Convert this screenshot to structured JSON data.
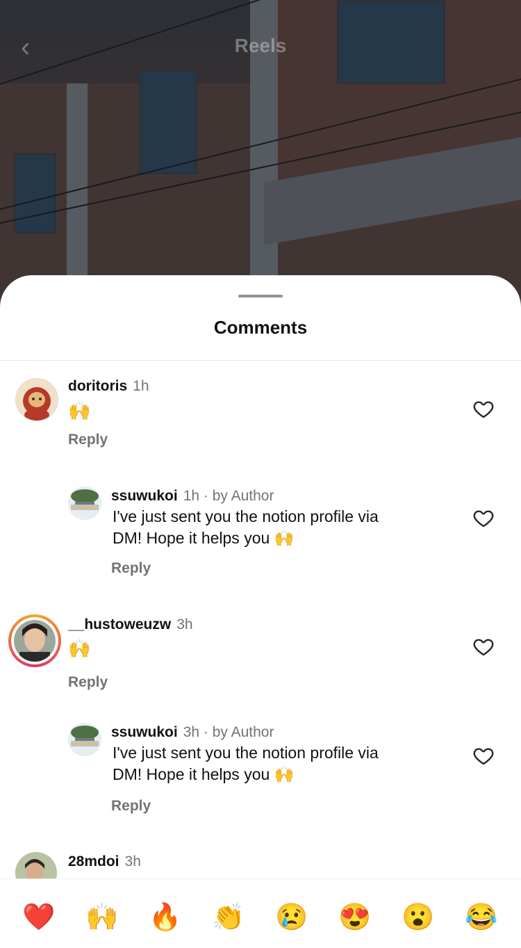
{
  "header": {
    "title": "Reels"
  },
  "sheet": {
    "title": "Comments"
  },
  "comments": [
    {
      "username": "doritoris",
      "time": "1h",
      "text": "🙌",
      "reply_label": "Reply"
    },
    {
      "username": "ssuwukoi",
      "time": "1h",
      "author_tag": "· by Author",
      "text_line1": "I've just sent you the notion profile via",
      "text_line2": "DM! Hope it helps you 🙌",
      "reply_label": "Reply"
    },
    {
      "username": "__hustoweuzw",
      "time": "3h",
      "text": "🙌",
      "reply_label": "Reply"
    },
    {
      "username": "ssuwukoi",
      "time": "3h",
      "author_tag": "· by Author",
      "text_line1": "I've just sent you the notion profile via",
      "text_line2": "DM! Hope it helps you 🙌",
      "reply_label": "Reply"
    },
    {
      "username": "28mdoi",
      "time": "3h"
    }
  ],
  "quick_reactions": [
    "❤️",
    "🙌",
    "🔥",
    "👏",
    "😢",
    "😍",
    "😮",
    "😂"
  ],
  "icons": {
    "back": "chevron-left-icon",
    "like": "heart-outline-icon"
  },
  "colors": {
    "story_ring": "#f5a623",
    "meta_gray": "#737373"
  }
}
